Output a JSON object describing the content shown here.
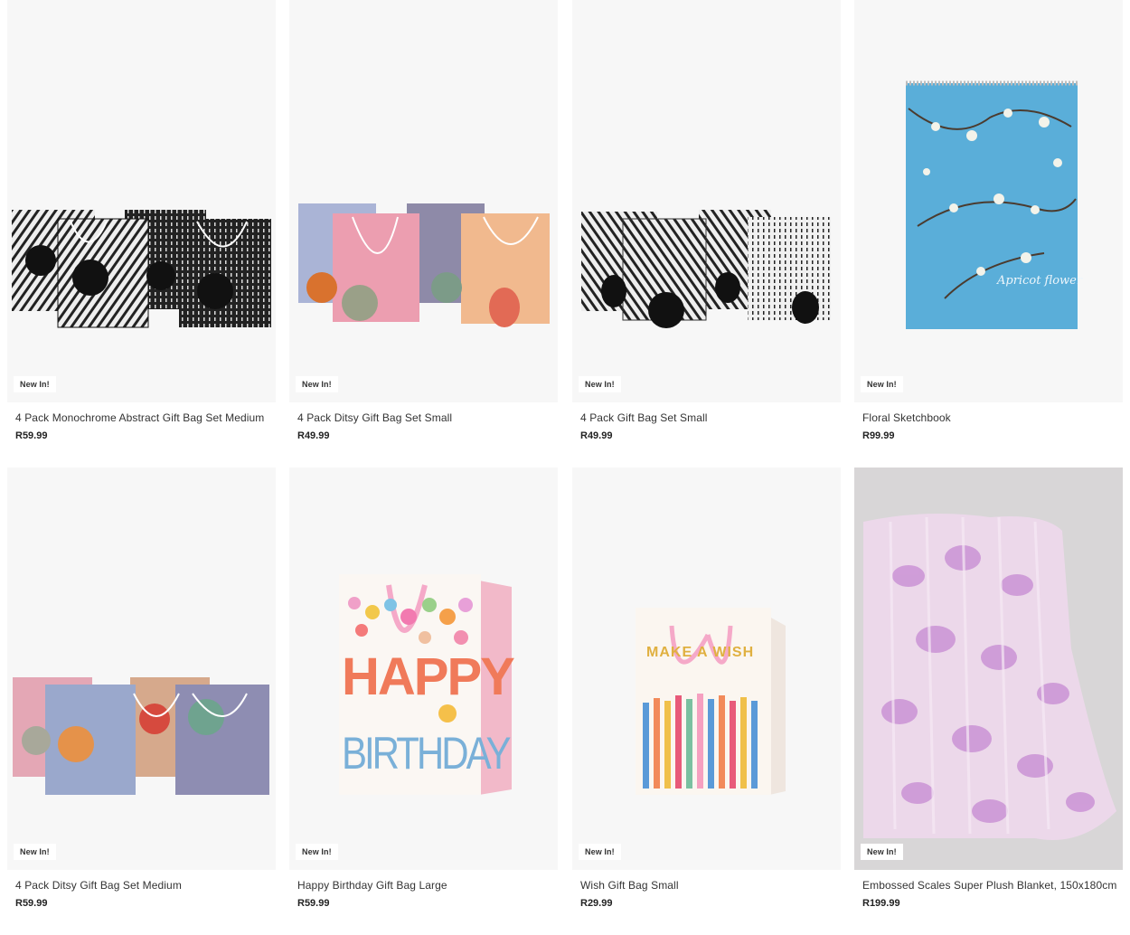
{
  "products": [
    {
      "name": "4 Pack Monochrome Abstract Gift Bag Set Medium",
      "price": "R59.99",
      "badge": "New In!"
    },
    {
      "name": "4 Pack Ditsy Gift Bag Set Small",
      "price": "R49.99",
      "badge": "New In!"
    },
    {
      "name": "4 Pack Gift Bag Set Small",
      "price": "R49.99",
      "badge": "New In!"
    },
    {
      "name": "Floral Sketchbook",
      "price": "R99.99",
      "badge": "New In!"
    },
    {
      "name": "4 Pack Ditsy Gift Bag Set Medium",
      "price": "R59.99",
      "badge": "New In!"
    },
    {
      "name": "Happy Birthday Gift Bag Large",
      "price": "R59.99",
      "badge": "New In!"
    },
    {
      "name": "Wish Gift Bag Small",
      "price": "R29.99",
      "badge": "New In!"
    },
    {
      "name": "Embossed Scales Super Plush Blanket, 150x180cm",
      "price": "R199.99",
      "badge": "New In!"
    }
  ],
  "sketchbook_cover_text": "Apricot flower",
  "birthday_bag_text": [
    "HAPPY",
    "BIRTHDAY"
  ],
  "wish_bag_text": "MAKE A WISH",
  "colors": {
    "tile_bg": "#f7f7f7",
    "price": "#222222",
    "badge_bg": "#ffffff"
  }
}
